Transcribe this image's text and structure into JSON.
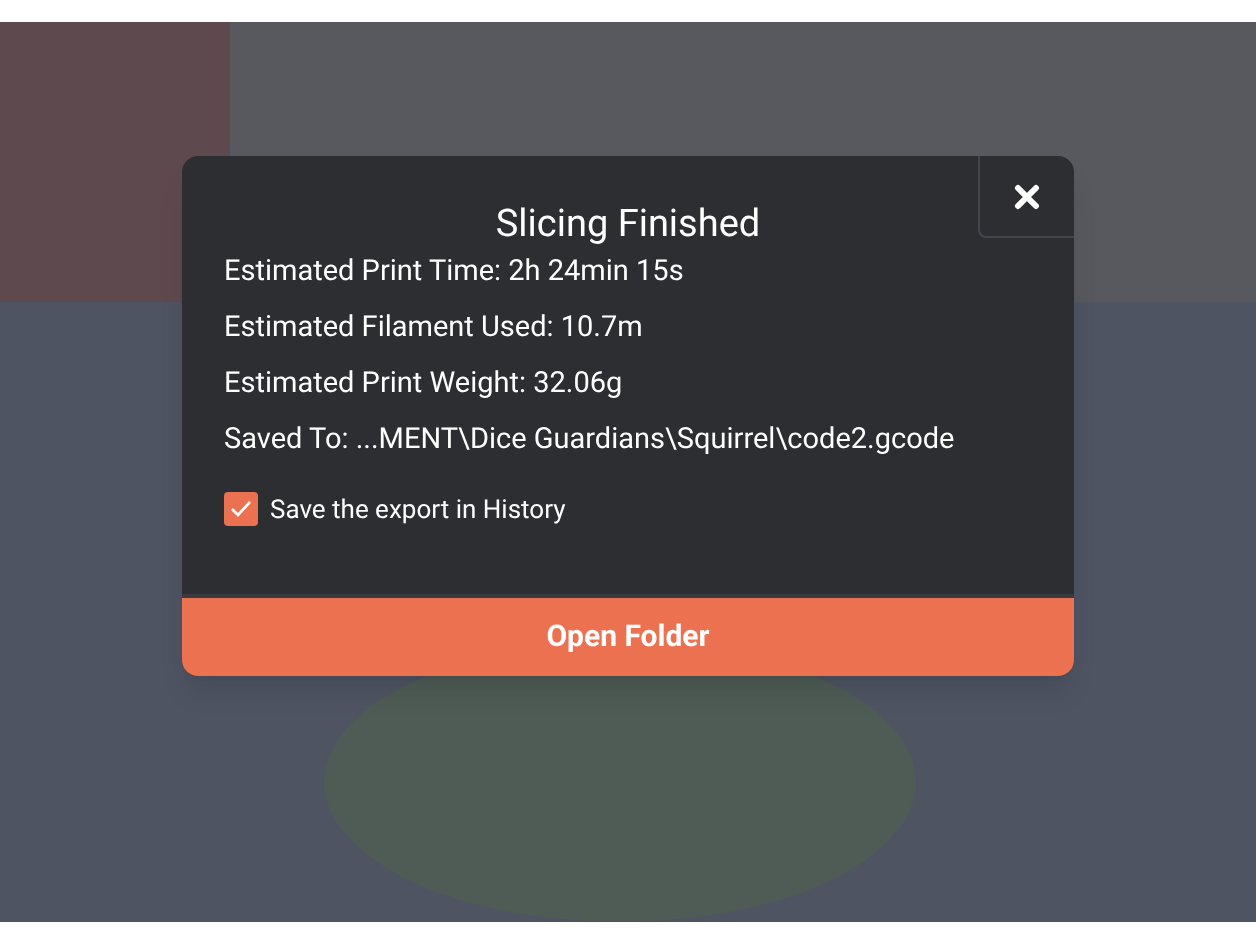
{
  "dialog": {
    "title": "Slicing Finished",
    "lines": [
      "Estimated Print Time: 2h 24min 15s",
      "Estimated Filament Used: 10.7m",
      "Estimated Print Weight: 32.06g",
      "Saved To: ...MENT\\Dice Guardians\\Squirrel\\code2.gcode"
    ],
    "save_history": {
      "label": "Save the export in History",
      "checked": true
    },
    "button": "Open Folder"
  }
}
